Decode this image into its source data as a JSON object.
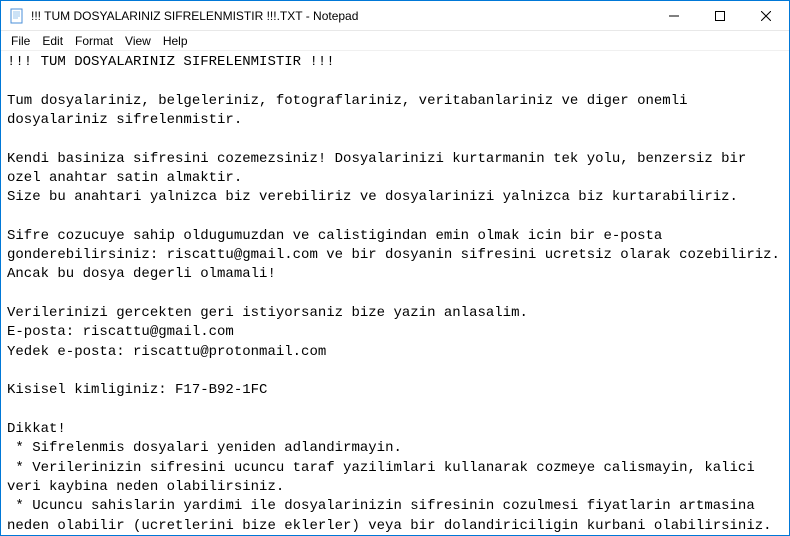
{
  "window": {
    "title": "!!! TUM DOSYALARINIZ SIFRELENMISTIR !!!.TXT - Notepad"
  },
  "menubar": {
    "file": "File",
    "edit": "Edit",
    "format": "Format",
    "view": "View",
    "help": "Help"
  },
  "body_text": "!!! TUM DOSYALARINIZ SIFRELENMISTIR !!!\n\nTum dosyalariniz, belgeleriniz, fotograflariniz, veritabanlariniz ve diger onemli dosyalariniz sifrelenmistir.\n\nKendi basiniza sifresini cozemezsiniz! Dosyalarinizi kurtarmanin tek yolu, benzersiz bir ozel anahtar satin almaktir.\nSize bu anahtari yalnizca biz verebiliriz ve dosyalarinizi yalnizca biz kurtarabiliriz.\n\nSifre cozucuye sahip oldugumuzdan ve calistigindan emin olmak icin bir e-posta gonderebilirsiniz: riscattu@gmail.com ve bir dosyanin sifresini ucretsiz olarak cozebiliriz.\nAncak bu dosya degerli olmamali!\n\nVerilerinizi gercekten geri istiyorsaniz bize yazin anlasalim.\nE-posta: riscattu@gmail.com\nYedek e-posta: riscattu@protonmail.com\n\nKisisel kimliginiz: F17-B92-1FC\n\nDikkat!\n * Sifrelenmis dosyalari yeniden adlandirmayin.\n * Verilerinizin sifresini ucuncu taraf yazilimlari kullanarak cozmeye calismayin, kalici veri kaybina neden olabilirsiniz.\n * Ucuncu sahislarin yardimi ile dosyalarinizin sifresinin cozulmesi fiyatlarin artmasina neden olabilir (ucretlerini bize eklerler) veya bir dolandiriciligin kurbani olabilirsiniz."
}
